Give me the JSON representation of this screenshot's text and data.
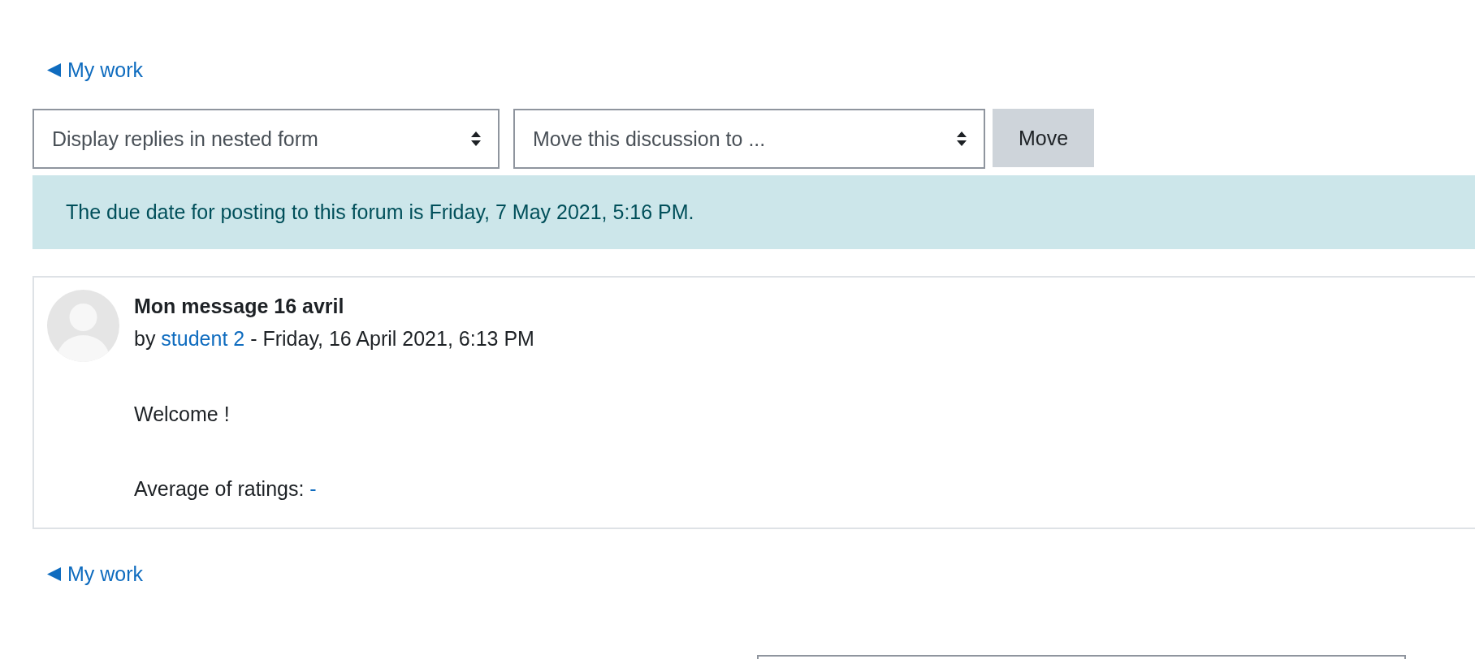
{
  "back_link_top": {
    "label": "My work"
  },
  "display_select": {
    "value": "Display replies in nested form"
  },
  "move_select": {
    "value": "Move this discussion to ..."
  },
  "move_button": {
    "label": "Move"
  },
  "notice": {
    "text": "The due date for posting to this forum is Friday, 7 May 2021, 5:16 PM."
  },
  "post": {
    "subject": "Mon message 16 avril",
    "byline_prefix": "by",
    "author": "student 2",
    "date": "- Friday, 16 April 2021, 6:13 PM",
    "message": "Welcome !",
    "rating_label": "Average of ratings:",
    "rating_value": "-"
  },
  "back_link_bottom": {
    "label": "My work"
  }
}
